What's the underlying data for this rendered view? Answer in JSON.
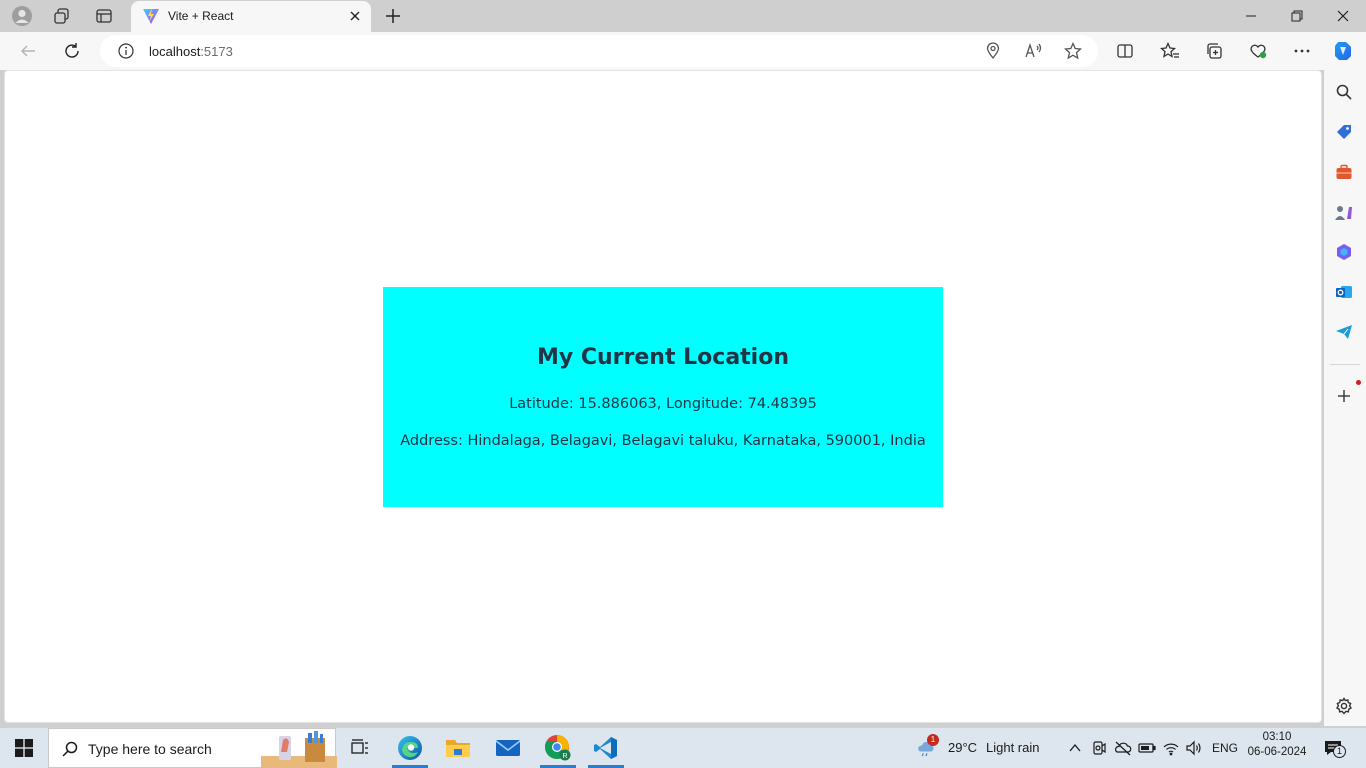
{
  "browser": {
    "tab_title": "Vite + React",
    "url_host": "localhost",
    "url_port": ":5173"
  },
  "page": {
    "heading": "My Current Location",
    "latitude_line": "Latitude: 15.886063, Longitude: 74.48395",
    "address_line": "Address: Hindalaga, Belagavi, Belagavi taluku, Karnataka, 590001, India",
    "card_color": "#00ffff"
  },
  "taskbar": {
    "search_placeholder": "Type here to search",
    "weather_temp": "29°C",
    "weather_desc": "Light rain",
    "weather_badge": "1",
    "language": "ENG",
    "time": "03:10",
    "date": "06-06-2024",
    "notification_count": "1"
  }
}
